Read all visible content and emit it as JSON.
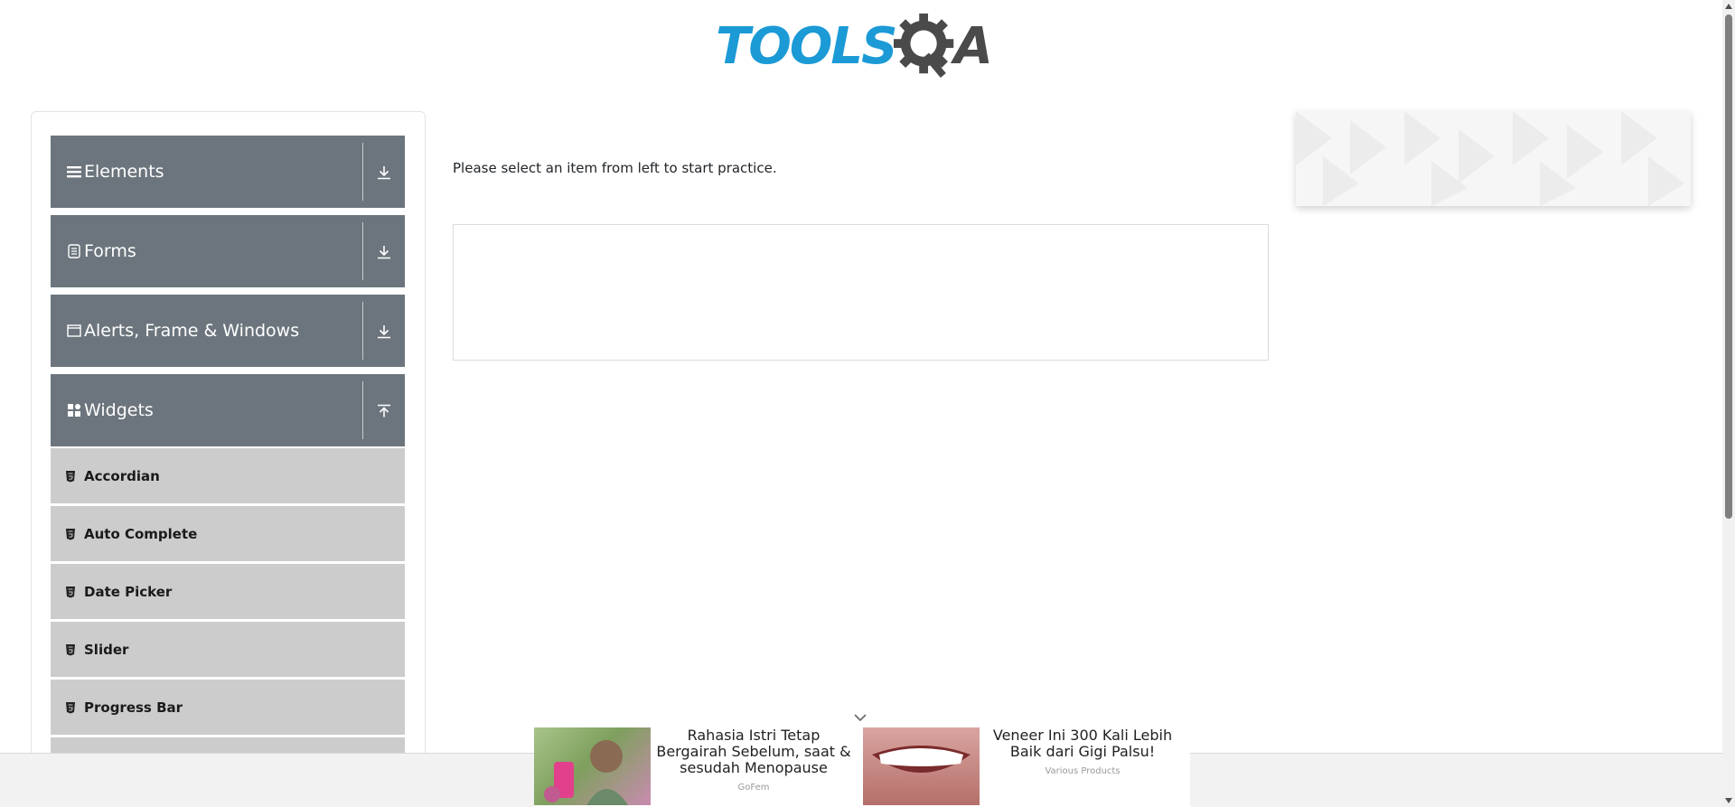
{
  "header": {
    "logo_text": "TOOLS",
    "logo_suffix": "A",
    "logo_alt": "TOOLSQA"
  },
  "sidebar": {
    "groups": [
      {
        "label": "Elements",
        "icon": "menu-icon",
        "expanded": false
      },
      {
        "label": "Forms",
        "icon": "document-icon",
        "expanded": false
      },
      {
        "label": "Alerts, Frame & Windows",
        "icon": "window-icon",
        "expanded": false
      },
      {
        "label": "Widgets",
        "icon": "widgets-icon",
        "expanded": true
      }
    ],
    "widget_items": [
      {
        "label": "Accordian"
      },
      {
        "label": "Auto Complete"
      },
      {
        "label": "Date Picker"
      },
      {
        "label": "Slider"
      },
      {
        "label": "Progress Bar"
      },
      {
        "label": ""
      }
    ]
  },
  "main": {
    "prompt": "Please select an item from left to start practice."
  },
  "ads": {
    "bottom": [
      {
        "title": "Rahasia Istri Tetap Bergairah Sebelum, saat & sesudah Menopause",
        "source": "GoFem"
      },
      {
        "title": "Veneer Ini 300 Kali Lebih Baik dari Gigi Palsu!",
        "source": "Various Products"
      }
    ]
  },
  "colors": {
    "brand_blue": "#1b9ad6",
    "group_bg": "#6c757d",
    "item_bg": "#cccccc"
  }
}
